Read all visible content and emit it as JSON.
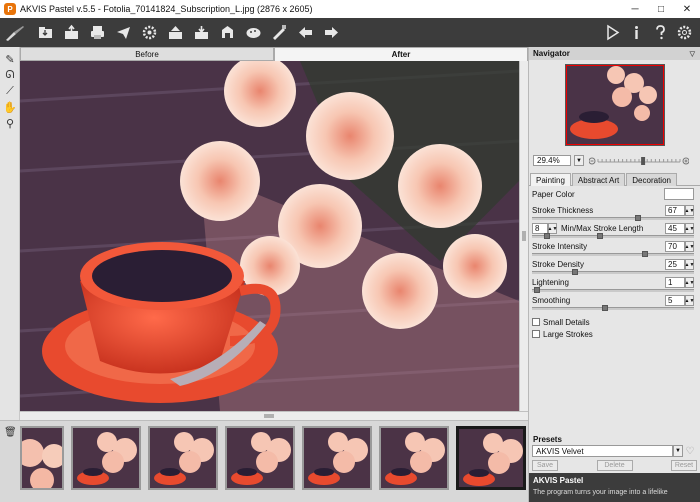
{
  "window": {
    "title": "AKVIS Pastel v.5.5 - Fotolia_70141824_Subscription_L.jpg (2876 x 2605)",
    "minimize": "─",
    "maximize": "□",
    "close": "✕"
  },
  "toolbar": {
    "icons": [
      "open-icon",
      "save-icon",
      "print-icon",
      "share-icon",
      "settings-gear-icon",
      "batch-icon",
      "export-icon",
      "import-icon",
      "preset-share-icon",
      "brush-share-icon",
      "back-arrow-icon",
      "forward-arrow-icon"
    ],
    "right_icons": [
      "run-icon",
      "info-icon",
      "help-icon",
      "preferences-icon"
    ]
  },
  "left_tools": [
    "brush-icon",
    "history-brush-icon",
    "smudge-icon",
    "hand-icon",
    "zoom-icon"
  ],
  "view_tabs": {
    "before": "Before",
    "after": "After"
  },
  "navigator": {
    "title": "Navigator",
    "zoom": "29.4%",
    "zoom_level": 0.55
  },
  "panel_tabs": {
    "painting": "Painting",
    "abstract": "Abstract Art",
    "decoration": "Decoration"
  },
  "settings": {
    "paper_color_label": "Paper Color",
    "paper_color": "#ffffff",
    "stroke_thickness_label": "Stroke Thickness",
    "stroke_thickness": "67",
    "stroke_length_label": "Min/Max Stroke Length",
    "stroke_length_min": "8",
    "stroke_length_max": "45",
    "stroke_intensity_label": "Stroke Intensity",
    "stroke_intensity": "70",
    "stroke_density_label": "Stroke Density",
    "stroke_density": "25",
    "lightening_label": "Lightening",
    "lightening": "1",
    "smoothing_label": "Smoothing",
    "smoothing": "5",
    "small_details_label": "Small Details",
    "large_strokes_label": "Large Strokes"
  },
  "presets": {
    "title": "Presets",
    "selected": "AKVIS Velvet",
    "save": "Save",
    "delete": "Delete",
    "reset": "Reset"
  },
  "about": {
    "title": "AKVIS Pastel",
    "desc": "The program turns your image into a lifelike"
  },
  "colors": {
    "toolbar_bg": "#3c3c3c",
    "table_bg": "#463344",
    "cup": "#e8472e",
    "rose": "#f6c0aa"
  }
}
